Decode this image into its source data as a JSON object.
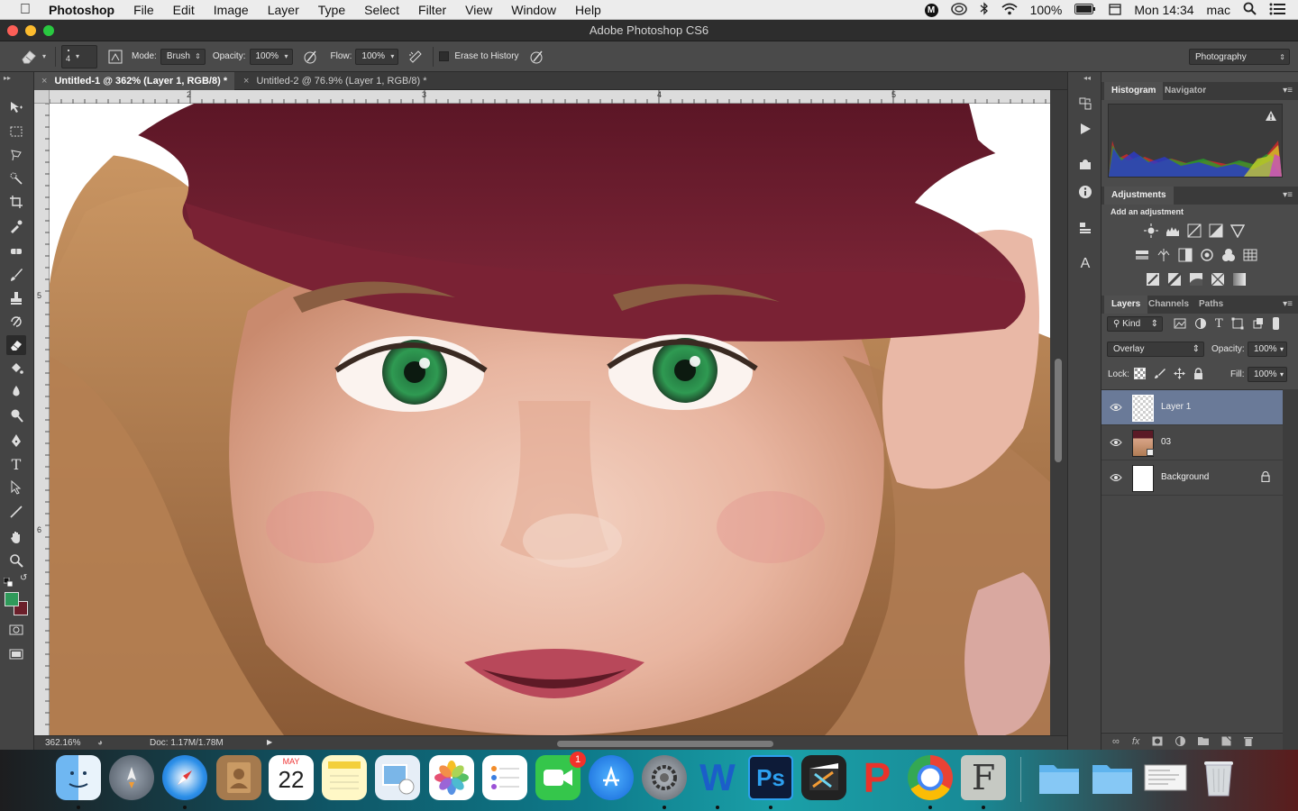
{
  "menubar": {
    "app_name": "Photoshop",
    "items": [
      "File",
      "Edit",
      "Image",
      "Layer",
      "Type",
      "Select",
      "Filter",
      "View",
      "Window",
      "Help"
    ],
    "battery": "100%",
    "clock": "Mon 14:34",
    "user": "mac"
  },
  "window": {
    "title": "Adobe Photoshop CS6"
  },
  "options": {
    "brush_size": "4",
    "mode_label": "Mode:",
    "mode_value": "Brush",
    "opacity_label": "Opacity:",
    "opacity_value": "100%",
    "flow_label": "Flow:",
    "flow_value": "100%",
    "erase_history_label": "Erase to History",
    "workspace": "Photography"
  },
  "tabs": [
    {
      "label": "Untitled-1 @ 362% (Layer 1, RGB/8) *"
    },
    {
      "label": "Untitled-2 @ 76.9% (Layer 1, RGB/8) *"
    }
  ],
  "rulers": {
    "top": [
      "2",
      "3",
      "4",
      "5"
    ],
    "left": [
      "5",
      "6"
    ]
  },
  "status": {
    "zoom": "362.16%",
    "doc": "Doc: 1.17M/1.78M"
  },
  "panels": {
    "histogram_tab": "Histogram",
    "navigator_tab": "Navigator",
    "adjustments_tab": "Adjustments",
    "add_adjustment": "Add an adjustment",
    "layers_tab": "Layers",
    "channels_tab": "Channels",
    "paths_tab": "Paths",
    "kind_label": "Kind",
    "blend_mode": "Overlay",
    "opacity_label": "Opacity:",
    "opacity_value": "100%",
    "lock_label": "Lock:",
    "fill_label": "Fill:",
    "fill_value": "100%"
  },
  "layers": [
    {
      "name": "Layer 1",
      "selected": true
    },
    {
      "name": "03",
      "selected": false
    },
    {
      "name": "Background",
      "selected": false
    }
  ],
  "dock": {
    "calendar_month": "MAY",
    "calendar_day": "22",
    "facetime_badge": "1",
    "ps_label": "Ps"
  },
  "colors": {
    "accent_selected_layer": "#6a7a98",
    "foreground_swatch": "#2f9a5a",
    "background_swatch": "#6b1f2a"
  }
}
